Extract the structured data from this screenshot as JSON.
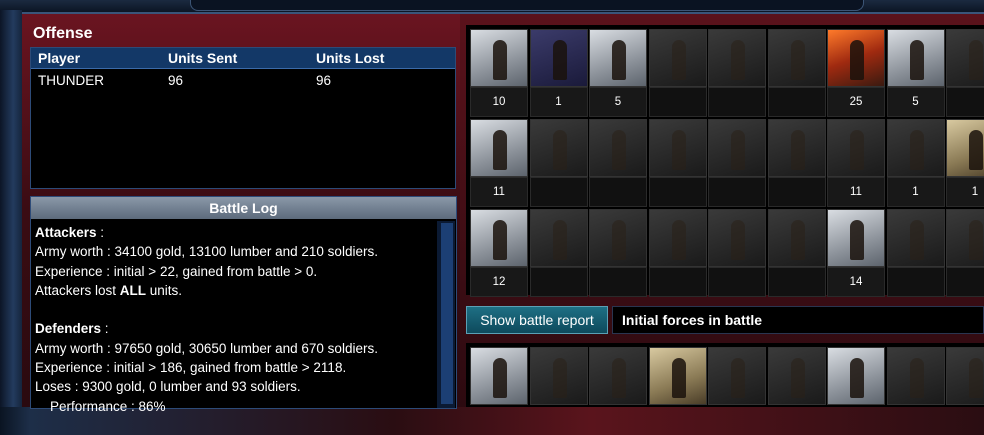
{
  "offense": {
    "title": "Offense",
    "headers": [
      "Player",
      "Units Sent",
      "Units Lost"
    ],
    "rows": [
      {
        "player": "THUNDER",
        "sent": "96",
        "lost": "96"
      }
    ]
  },
  "battle_log": {
    "title": "Battle Log",
    "lines": [
      [
        "Attackers",
        " :"
      ],
      [
        "Army worth : 34100 gold, 13100 lumber and 210 soldiers."
      ],
      [
        "Experience : initial > 22, gained from battle > 0."
      ],
      [
        "Attackers lost ",
        "ALL",
        " units."
      ],
      [
        ""
      ],
      [
        "Defenders",
        " :"
      ],
      [
        "Army worth : 97650 gold, 30650 lumber and 670 soldiers."
      ],
      [
        "Experience : initial > 186, gained from battle > 2118."
      ],
      [
        "Loses : 9300 gold, 0 lumber and 93 soldiers."
      ],
      [
        "    Performance : 86%"
      ]
    ]
  },
  "units_grid": {
    "rows": [
      [
        "10",
        "1",
        "5",
        "",
        "",
        "",
        "25",
        "5",
        ""
      ],
      [
        "11",
        "",
        "",
        "",
        "",
        "",
        "11",
        "1",
        "1"
      ],
      [
        "12",
        "",
        "",
        "",
        "",
        "",
        "14",
        "",
        ""
      ]
    ]
  },
  "controls": {
    "show_battle_report": "Show battle report",
    "initial_forces_label": "Initial forces in battle"
  }
}
